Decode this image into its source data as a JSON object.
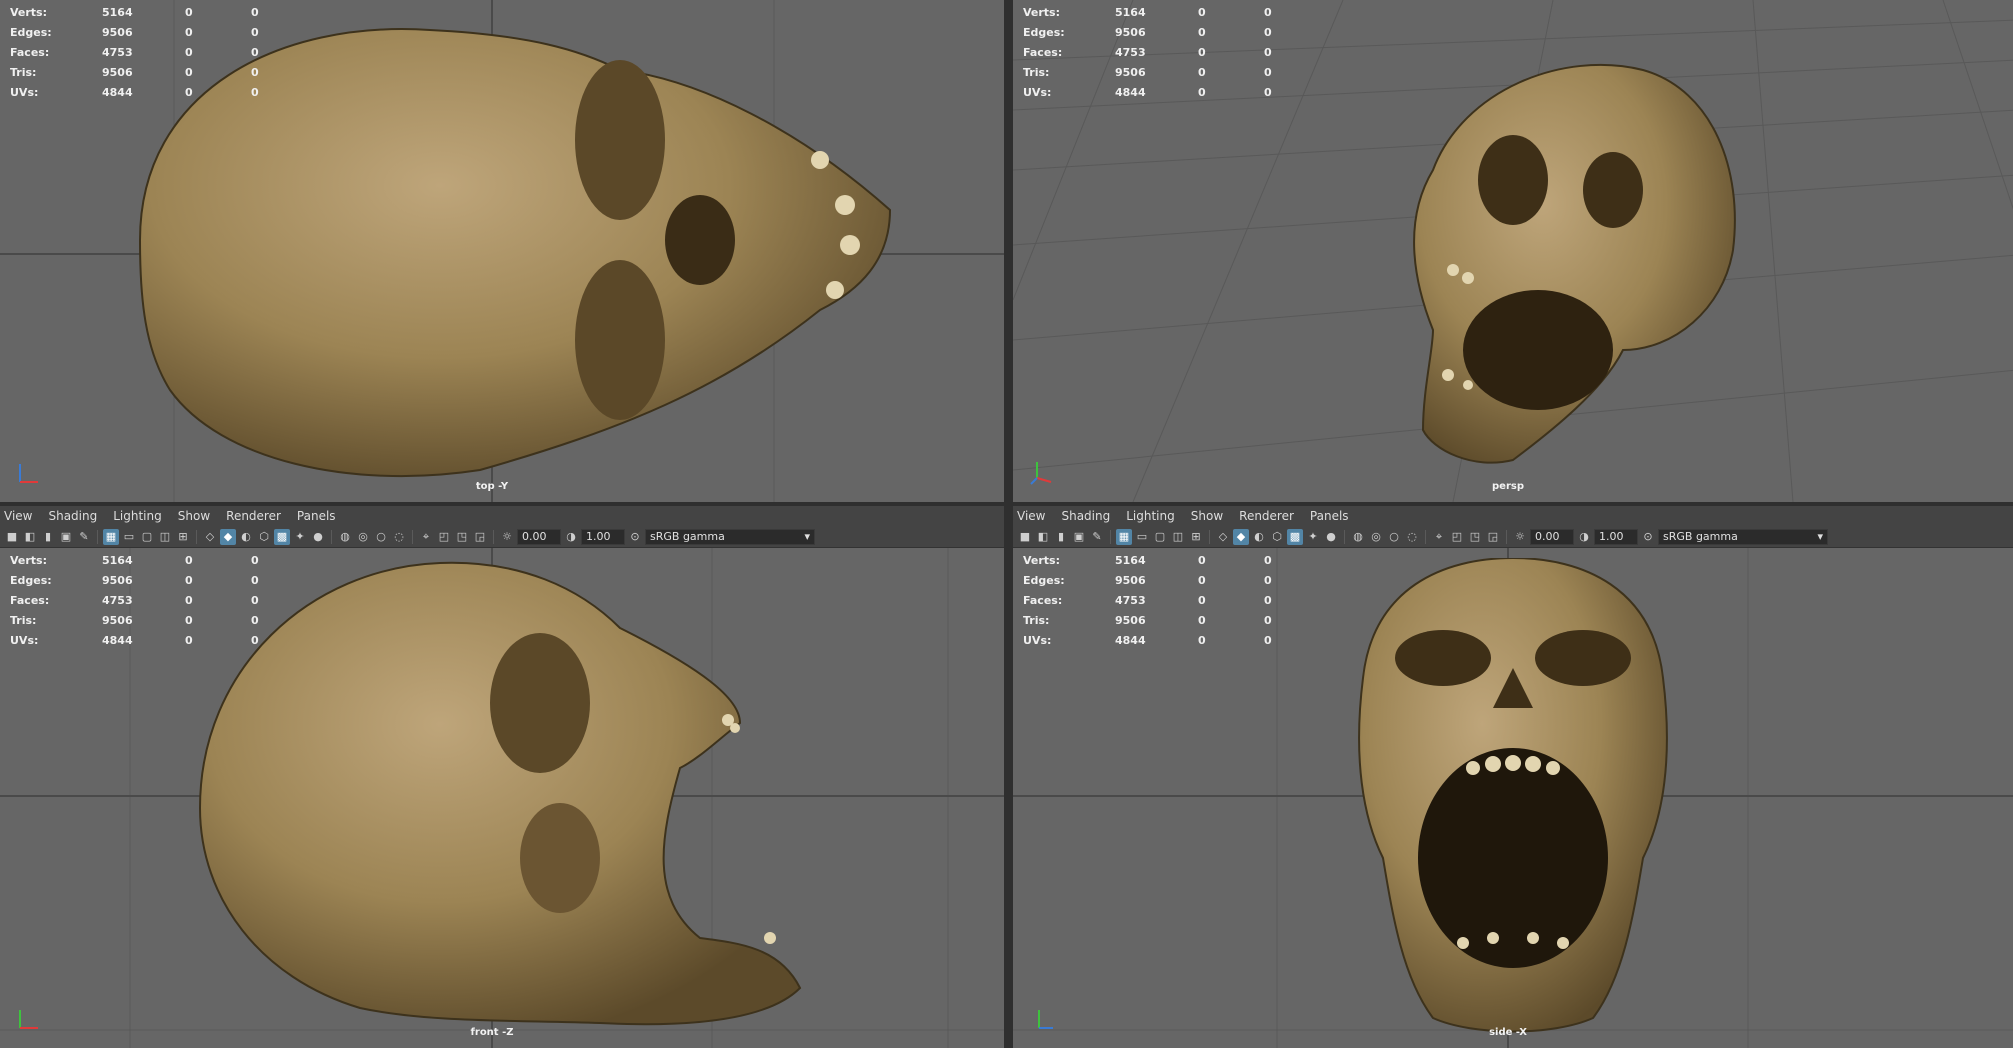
{
  "stats": {
    "labels": [
      "Verts:",
      "Edges:",
      "Faces:",
      "Tris:",
      "UVs:"
    ],
    "values": [
      [
        "5164",
        "0",
        "0"
      ],
      [
        "9506",
        "0",
        "0"
      ],
      [
        "4753",
        "0",
        "0"
      ],
      [
        "9506",
        "0",
        "0"
      ],
      [
        "4844",
        "0",
        "0"
      ]
    ]
  },
  "menu": [
    "View",
    "Shading",
    "Lighting",
    "Show",
    "Renderer",
    "Panels"
  ],
  "toolbar": {
    "exposure": "0.00",
    "gamma": "1.00",
    "color_space": "sRGB gamma"
  },
  "viewports": {
    "top_left": {
      "camera": "top -Y"
    },
    "top_right": {
      "camera": "persp"
    },
    "bottom_left": {
      "camera": "front -Z"
    },
    "bottom_right": {
      "camera": "side -X"
    }
  },
  "colors": {
    "viewport_bg": "#666666",
    "grid": "#5b5b5b",
    "panel_bg": "#444444",
    "bone": "#a38a5a",
    "highlight": "#5285a6"
  }
}
